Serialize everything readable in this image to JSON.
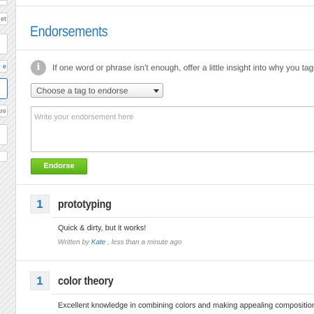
{
  "gutter": {
    "tabs": [
      "et",
      "",
      "e",
      "",
      "are",
      "",
      ""
    ]
  },
  "section": {
    "title": "Endorsements",
    "info_icon_glyph": "i",
    "info_text": "If one word or phrase isn't enough, offer a little insight into why you tagged"
  },
  "form": {
    "tag_select_value": "Choose a tag to endorse",
    "textarea_placeholder": "Write your endorsement here",
    "submit_label": "Endorse"
  },
  "endorsements": [
    {
      "count": "1",
      "tag": "prototyping",
      "text": "Quick & dirty, but it works!",
      "written_by": "Written by",
      "author": "Kate",
      "time": ", less than a minute ago"
    },
    {
      "count": "1",
      "tag": "color theory",
      "text": "Excellent knowledge in combining colors and making appealing composition."
    }
  ],
  "colors": {
    "accent": "#2a7ab8",
    "button_green": "#6cc122",
    "background": "#ececec"
  }
}
